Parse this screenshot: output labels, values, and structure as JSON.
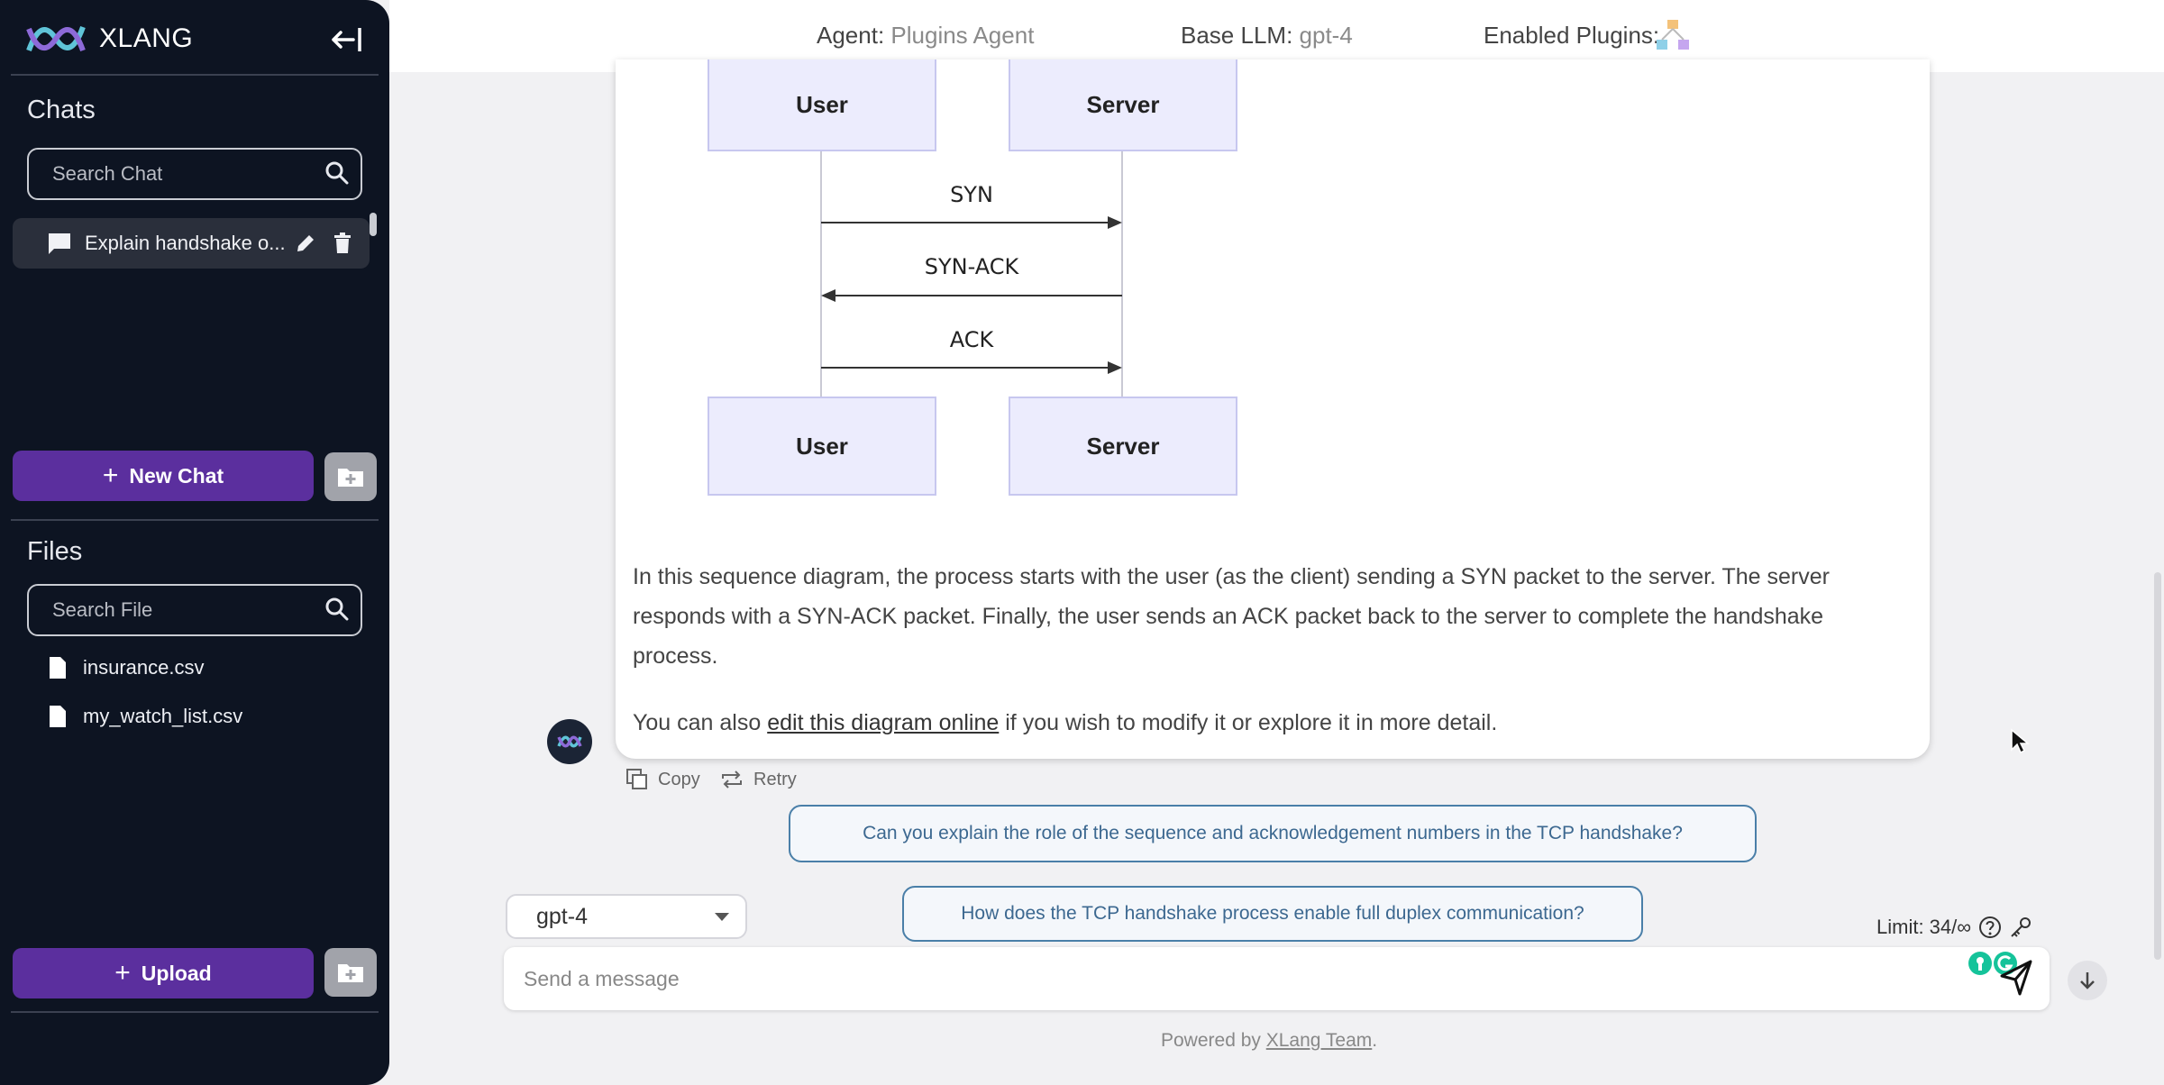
{
  "sidebar": {
    "brand": "XLANG",
    "chats_title": "Chats",
    "search_chat_placeholder": "Search Chat",
    "chats": [
      {
        "label": "Explain handshake o..."
      }
    ],
    "new_chat_label": "New Chat",
    "files_title": "Files",
    "search_file_placeholder": "Search File",
    "files": [
      "insurance.csv",
      "my_watch_list.csv"
    ],
    "upload_label": "Upload"
  },
  "header": {
    "agent_label": "Agent:",
    "agent_value": "Plugins Agent",
    "llm_label": "Base LLM:",
    "llm_value": "gpt-4",
    "plugins_label": "Enabled Plugins:"
  },
  "diagram": {
    "top_left": "User",
    "top_right": "Server",
    "bottom_left": "User",
    "bottom_right": "Server",
    "msg1": "SYN",
    "msg2": "SYN-ACK",
    "msg3": "ACK"
  },
  "message": {
    "paragraph": "In this sequence diagram, the process starts with the user (as the client) sending a SYN packet to the server. The server responds with a SYN-ACK packet. Finally, the user sends an ACK packet back to the server to complete the handshake process.",
    "line2_prefix": "You can also ",
    "link_text": "edit this diagram online",
    "line2_suffix": " if you wish to modify it or explore it in more detail."
  },
  "actions": {
    "copy": "Copy",
    "retry": "Retry"
  },
  "suggestions": [
    "Can you explain the role of the sequence and acknowledgement numbers in the TCP handshake?",
    "How does the TCP handshake process enable full duplex communication?"
  ],
  "composer": {
    "model": "gpt-4",
    "limit": "Limit: 34/∞",
    "placeholder": "Send a message"
  },
  "footer": {
    "prefix": "Powered by ",
    "link": "XLang Team",
    "suffix": "."
  },
  "colors": {
    "sidebar_bg": "#0d1422",
    "accent_purple": "#5b2f9e",
    "suggest_border": "#4a7fa8"
  }
}
